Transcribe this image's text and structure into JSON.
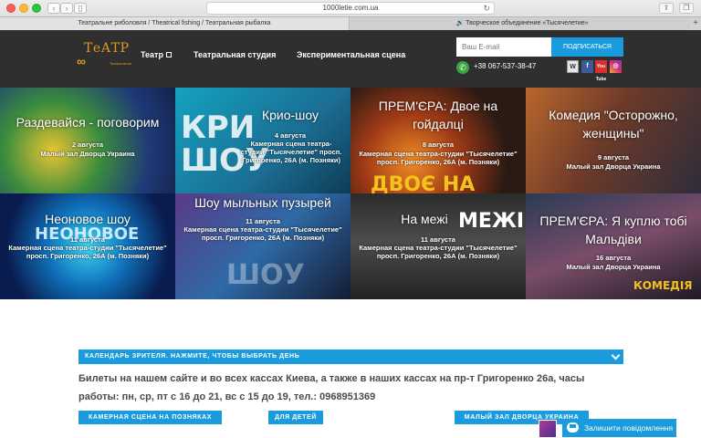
{
  "browser": {
    "url": "1000letie.com.ua",
    "tabs": [
      {
        "label": "Театральне риболовля / Theatrical fishing / Театральная рыбалка"
      },
      {
        "label": "Творческое объединение «Тысячелетие»"
      }
    ],
    "new_tab": "+"
  },
  "header": {
    "logo_text": "ТеАТР",
    "logo_symbol": "∞",
    "logo_sub": "Тысячелетие",
    "menu": [
      {
        "label": "Театр"
      },
      {
        "label": "Театральная студия"
      },
      {
        "label": "Экспериментальная сцена"
      }
    ],
    "email_placeholder": "Ваш E-mail",
    "subscribe_label": "ПОДПИСАТЬСЯ",
    "phone": "+38 067-537-38-47",
    "social": [
      "W",
      "f",
      "You Tube",
      "◎"
    ]
  },
  "events": [
    {
      "title": "Раздевайся - поговорим",
      "date": "2 августа",
      "place": "Малый зал Дворца Украина",
      "bigword": ""
    },
    {
      "title": "Крио-шоу",
      "date": "4 августа",
      "place": "Камерная сцена театра-студии \"Тысячелетие\" просп. Григоренко, 26А (м. Позняки)",
      "bigword": "КРИ ШОУ"
    },
    {
      "title": "ПРЕМ'ЄРА: Двое на гойдалці",
      "date": "8 августа",
      "place": "Камерная сцена театра-студии \"Тысячелетие\" просп. Григоренко, 26А (м. Позняки)",
      "bigword": "ДВОЄ НА"
    },
    {
      "title": "Комедия \"Осторожно, женщины\"",
      "date": "9 августа",
      "place": "Малый зал Дворца Украина",
      "bigword": ""
    },
    {
      "title": "Неоновое шоу",
      "date": "11 августа",
      "place": "Камерная сцена театра-студии \"Тысячелетие\" просп. Григоренко, 26А (м. Позняки)",
      "bigword": "НЕОНОВОЕ"
    },
    {
      "title": "Шоу мыльных пузырей",
      "date": "11 августа",
      "place": "Камерная сцена театра-студии \"Тысячелетие\" просп. Григоренко, 26А (м. Позняки)",
      "bigword": "ШОУ"
    },
    {
      "title": "На межі",
      "date": "11 августа",
      "place": "Камерная сцена театра-студии \"Тысячелетие\" просп. Григоренко, 26А (м. Позняки)",
      "bigword": "МЕЖІ"
    },
    {
      "title": "ПРЕМ'ЄРА: Я куплю тобі Мальдіви",
      "date": "16 августа",
      "place": "Малый зал Дворца Украина",
      "bigword": "КОМЕДІЯ"
    }
  ],
  "calendar_label": "КАЛЕНДАРЬ ЗРИТЕЛЯ. НАЖМИТЕ, ЧТОБЫ ВЫБРАТЬ ДЕНЬ",
  "info_text": "Билеты на нашем сайте и во всех кассах Киева, а также в наших кассах на пр-т Григоренко 26а, часы работы: пн, ср, пт с 16 до 21, вс с 15 до 19, тел.: 0968951369",
  "venues": [
    {
      "label": "КАМЕРНАЯ СЦЕНА НА ПОЗНЯКАХ"
    },
    {
      "label": "ДЛЯ ДЕТЕЙ"
    },
    {
      "label": "МАЛЫЙ ЗАЛ ДВОРЦА УКРАИНА"
    }
  ],
  "chat_label": "Залишити повідомлення",
  "colors": {
    "accent": "#1a9bde",
    "header_bg": "#2f2f2f",
    "logo": "#e49a1f"
  }
}
